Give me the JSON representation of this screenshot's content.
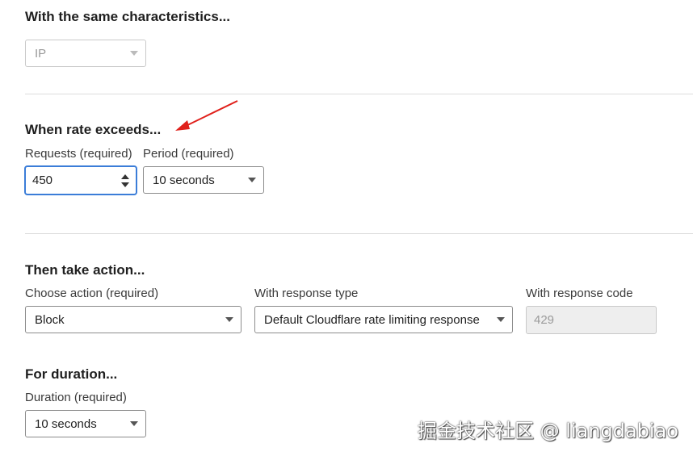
{
  "characteristics": {
    "heading": "With the same characteristics...",
    "select_value": "IP"
  },
  "rate": {
    "heading": "When rate exceeds...",
    "requests_label": "Requests (required)",
    "requests_value": "450",
    "period_label": "Period (required)",
    "period_value": "10 seconds"
  },
  "action": {
    "heading": "Then take action...",
    "choose_label": "Choose action (required)",
    "choose_value": "Block",
    "response_type_label": "With response type",
    "response_type_value": "Default Cloudflare rate limiting response",
    "response_code_label": "With response code",
    "response_code_value": "429"
  },
  "duration": {
    "heading": "For duration...",
    "label": "Duration (required)",
    "value": "10 seconds"
  },
  "annotation": {
    "arrow_icon": "red-arrow-icon",
    "arrow_color": "#e0201b"
  },
  "watermark": {
    "text": "掘金技术社区 @ liangdabiao"
  }
}
